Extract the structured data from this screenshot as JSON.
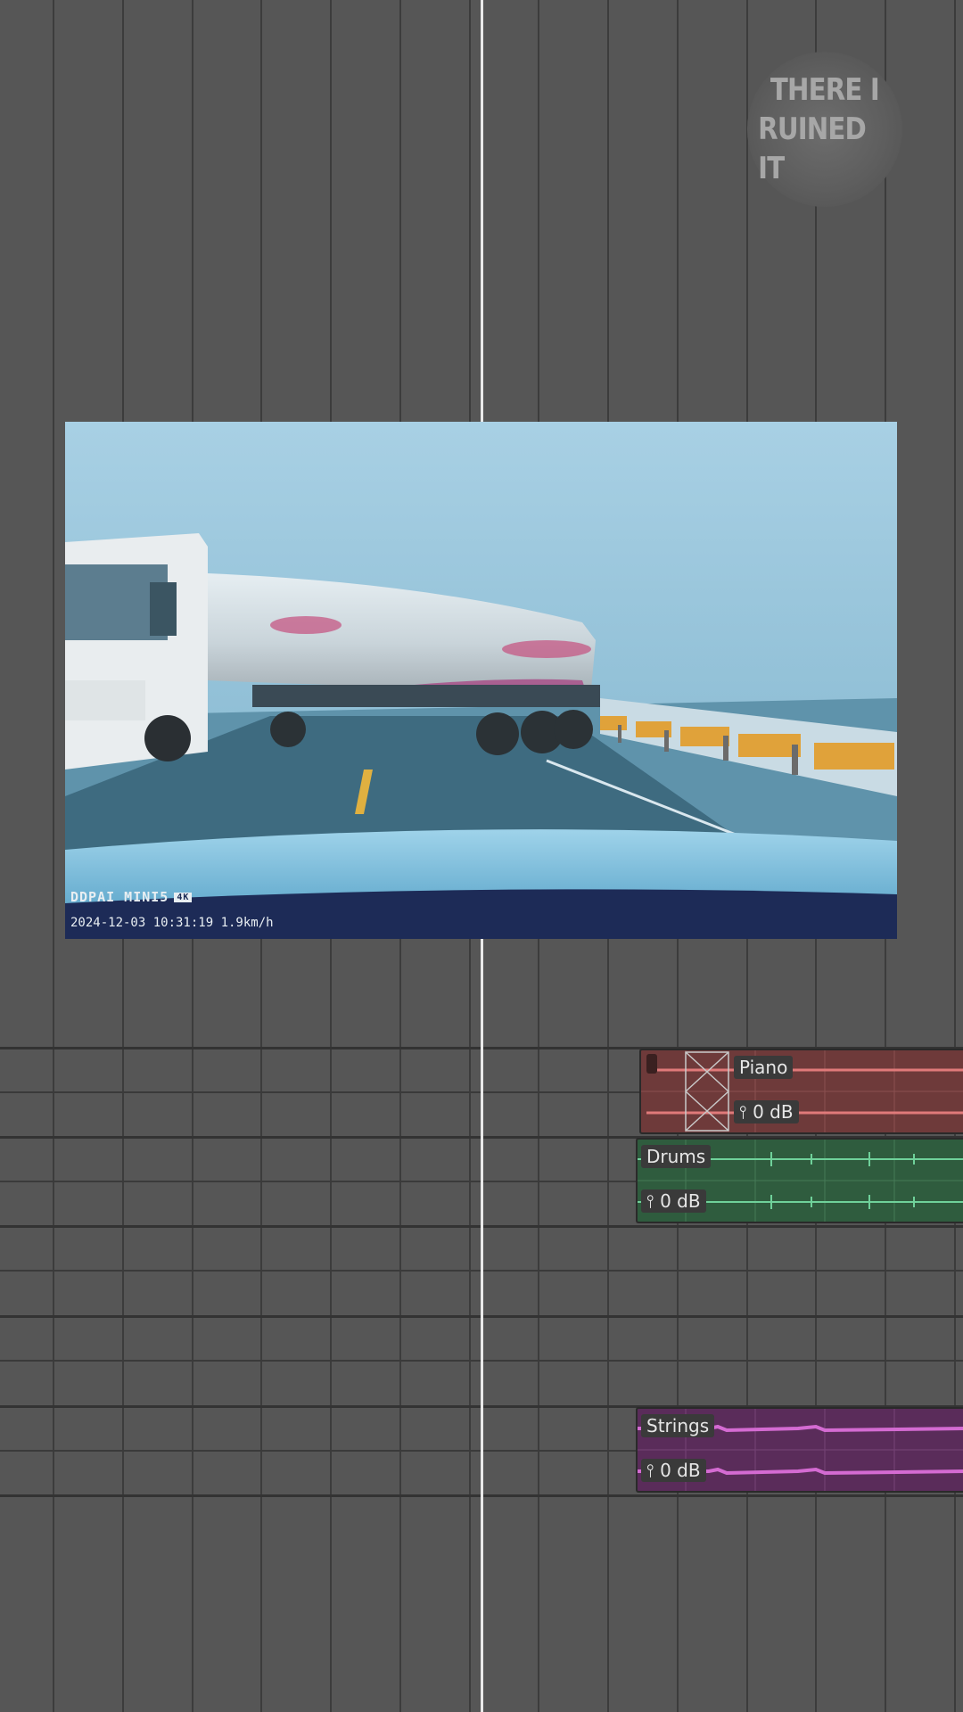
{
  "watermark": {
    "line1": "THERE I",
    "line2": "RUINED IT"
  },
  "video": {
    "camera_brand": "DDPAI MINI5",
    "resolution_badge": "4K",
    "timestamp": "2024-12-03 10:31:19  1.9km/h"
  },
  "tracks": [
    {
      "name": "Piano",
      "volume": "0 dB",
      "color": "#e07a7a",
      "bg": "#6e3a3a"
    },
    {
      "name": "Drums",
      "volume": "0 dB",
      "color": "#6fd19a",
      "bg": "#2f5c3e"
    },
    {
      "name": "Strings",
      "volume": "0 dB",
      "color": "#d46bd2",
      "bg": "#5a2c5a"
    }
  ],
  "colors": {
    "background": "#565656",
    "playhead": "#e9e9e9"
  }
}
